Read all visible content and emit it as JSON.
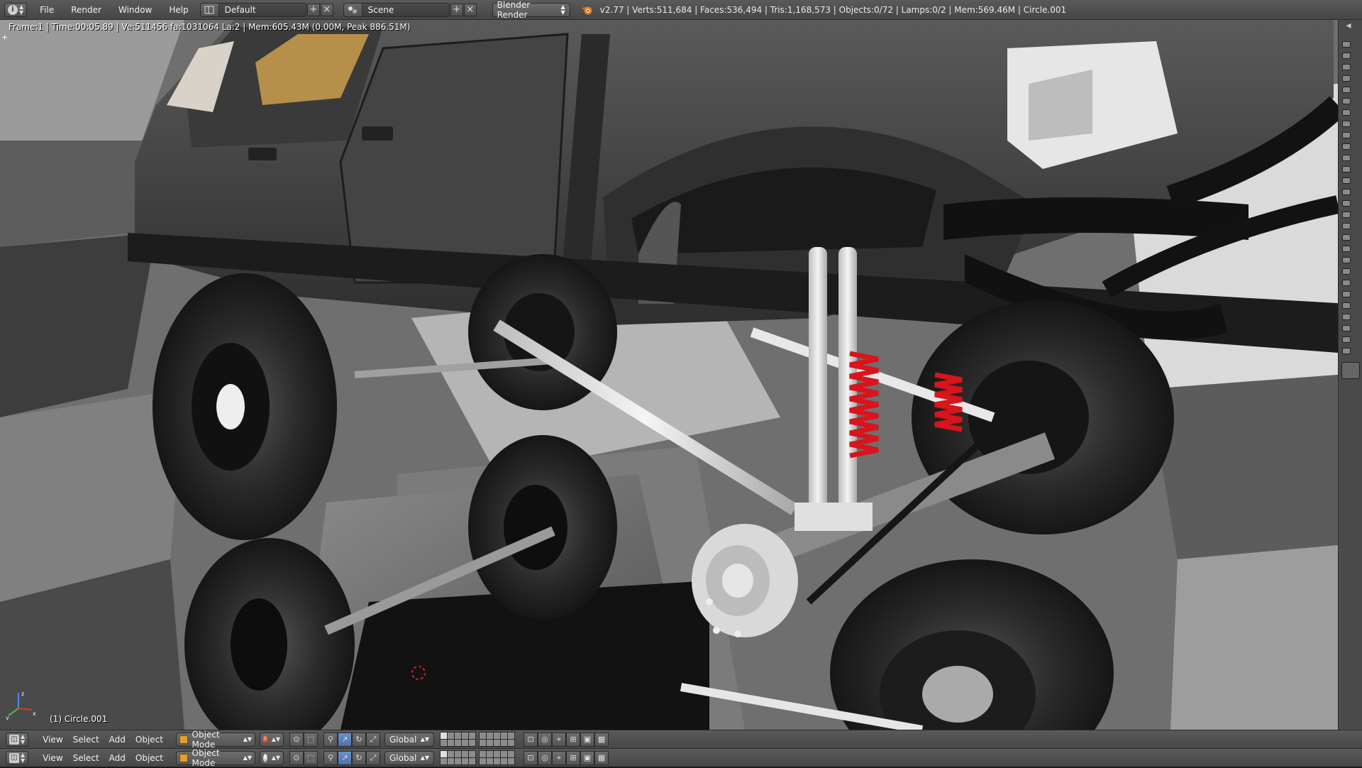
{
  "topbar": {
    "editor_type_icon": "info-icon",
    "menus": [
      "File",
      "Render",
      "Window",
      "Help"
    ],
    "screen_layout": "Default",
    "scene": "Scene",
    "render_engine": "Blender Render",
    "stats": "v2.77 | Verts:511,684 | Faces:536,494 | Tris:1,168,573 | Objects:0/72 | Lamps:0/2 | Mem:569.46M | Circle.001"
  },
  "viewport": {
    "frame_info": "Frame:1 | Time:00:05.89 | Ve:511456 fa:1031064 La:2 | Mem:605.43M (0.00M, Peak 886.51M)",
    "active_object_label": "(1) Circle.001"
  },
  "view_headers": [
    {
      "menus": [
        "View",
        "Select",
        "Add",
        "Object"
      ],
      "mode": "Object Mode",
      "viewport_shading": "solid",
      "orientation": "Global"
    },
    {
      "menus": [
        "View",
        "Select",
        "Add",
        "Object"
      ],
      "mode": "Object Mode",
      "viewport_shading": "solid-white",
      "orientation": "Global"
    }
  ],
  "colors": {
    "header_bg": "#4d4d4d",
    "viewport_bg": "#6c6c6c",
    "coil_spring": "#d8141c",
    "accent_blue": "#5680c2",
    "object_orange": "#e0a030"
  }
}
